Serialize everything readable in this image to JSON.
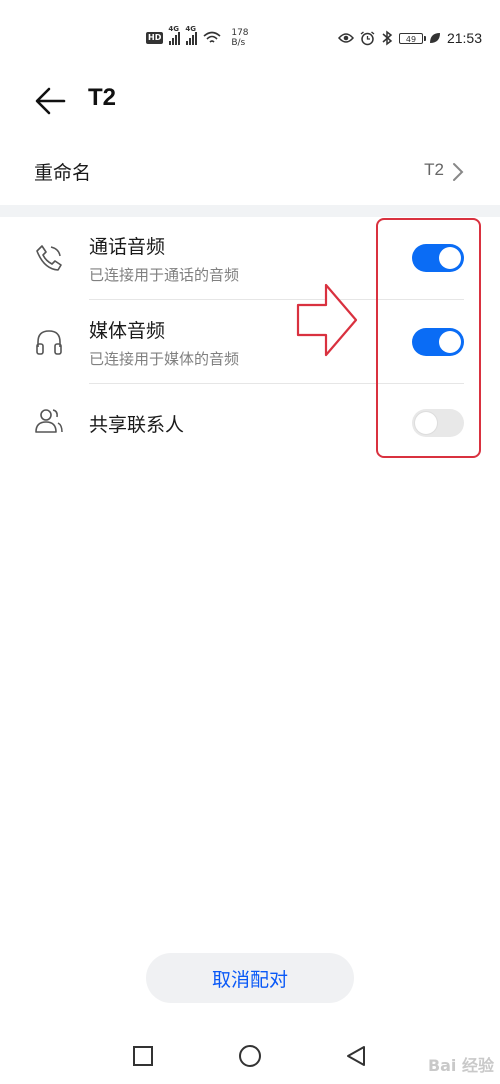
{
  "status_bar": {
    "network_badge": "HD",
    "signal_1_label": "4G",
    "signal_2_label": "4G",
    "speed_value": "178",
    "speed_unit": "B/s",
    "battery_level": "49",
    "time": "21:53",
    "icons": [
      "eye-icon",
      "alarm-icon",
      "bluetooth-icon",
      "battery-icon",
      "leaf-icon"
    ]
  },
  "header": {
    "title": "T2",
    "back_icon": "arrow-left-icon"
  },
  "rename": {
    "label": "重命名",
    "value": "T2"
  },
  "items": [
    {
      "name": "通话音频",
      "desc": "已连接用于通话的音频",
      "icon": "phone-icon",
      "enabled": true
    },
    {
      "name": "媒体音频",
      "desc": "已连接用于媒体的音频",
      "icon": "headphones-icon",
      "enabled": true
    },
    {
      "name": "共享联系人",
      "desc": "",
      "icon": "contacts-icon",
      "enabled": false
    }
  ],
  "unpair_label": "取消配对",
  "nav": [
    "square-icon",
    "circle-icon",
    "triangle-back-icon"
  ],
  "watermark": "Bai 经验",
  "colors": {
    "accent": "#0a6cf5",
    "annotation": "#d9313f"
  }
}
